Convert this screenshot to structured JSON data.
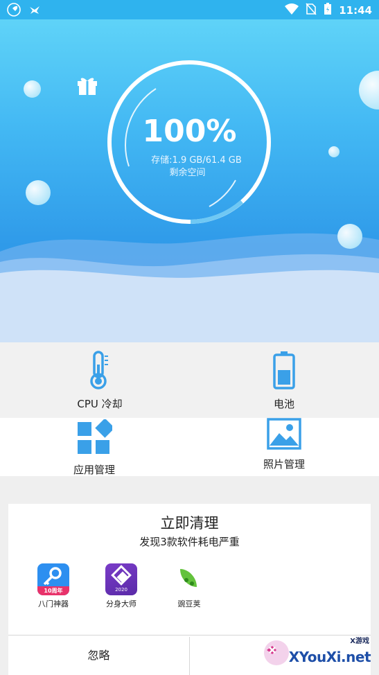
{
  "status_bar": {
    "time": "11:44",
    "left_icons": [
      "rocket-icon",
      "bird-icon"
    ],
    "right_icons": [
      "wifi-icon",
      "no-sim-icon",
      "battery-icon"
    ]
  },
  "hero": {
    "percent": "100%",
    "storage": "存储:1.9 GB/61.4 GB",
    "remain_label": "剩余空间",
    "ring_fill_fraction": 1.0
  },
  "tools": [
    {
      "label": "CPU 冷却",
      "icon": "thermometer-icon"
    },
    {
      "label": "电池",
      "icon": "battery-icon"
    },
    {
      "label": "应用管理",
      "icon": "apps-grid-icon"
    },
    {
      "label": "照片管理",
      "icon": "photo-icon"
    }
  ],
  "clean_card": {
    "title": "立即清理",
    "subtitle": "发现3款软件耗电严重",
    "apps": [
      {
        "name": "八门神器",
        "icon": "bamen-shenqi-icon",
        "badge": "10周年"
      },
      {
        "name": "分身大师",
        "icon": "fenshen-dashi-icon",
        "badge": "2020"
      },
      {
        "name": "豌豆荚",
        "icon": "wandoujia-icon"
      }
    ]
  },
  "actions": {
    "ignore_label": "忽略"
  },
  "watermark": {
    "text": "XYouXi.net",
    "small_text": "X游戏"
  },
  "colors": {
    "accent": "#3aa3ea",
    "hero_top": "#5fd3f8",
    "hero_bottom": "#3c8fe6",
    "icon_blue": "#3aa0e8"
  }
}
